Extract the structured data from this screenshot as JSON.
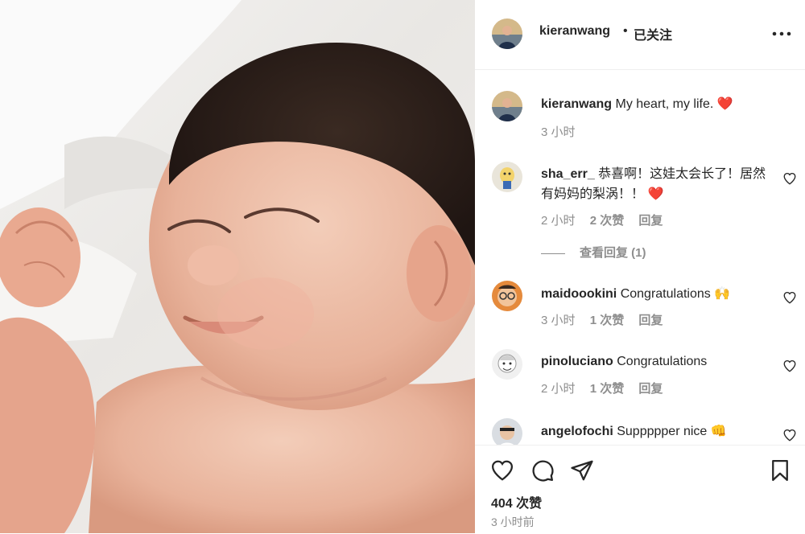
{
  "post": {
    "author": "kieranwang",
    "follow_status": "已关注",
    "separator": "•",
    "caption": "My heart, my life.",
    "caption_emoji": "❤️",
    "caption_time": "3 小时",
    "likes": "404 次赞",
    "posted": "3 小时前"
  },
  "comments": [
    {
      "user": "sha_err_",
      "text": "恭喜啊！这娃太会长了！居然有妈妈的梨涡！！",
      "emoji": "❤️",
      "time": "2 小时",
      "likes": "2 次赞",
      "reply": "回复",
      "view_replies": "查看回复 (1)"
    },
    {
      "user": "maidoookini",
      "text": "Congratulations",
      "emoji": "🙌",
      "time": "3 小时",
      "likes": "1 次赞",
      "reply": "回复"
    },
    {
      "user": "pinoluciano",
      "text": "Congratulations",
      "time": "2 小时",
      "likes": "1 次赞",
      "reply": "回复"
    },
    {
      "user": "angelofochi",
      "text": "Suppppper nice",
      "emoji": "👊"
    }
  ],
  "icons": {
    "like": "heart-icon",
    "comment": "comment-icon",
    "share": "send-icon",
    "save": "bookmark-icon",
    "more": "more-options-icon"
  },
  "colors": {
    "text": "#262626",
    "secondary": "#8e8e8e",
    "heart": "#ed4956",
    "divider": "#efefef"
  }
}
